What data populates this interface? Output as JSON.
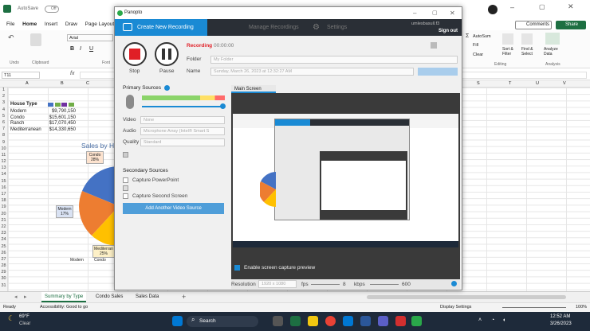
{
  "excel": {
    "autosave": "AutoSave",
    "autosave_state": "Off",
    "menu": [
      "File",
      "Home",
      "Insert",
      "Draw",
      "Page Layout"
    ],
    "comments": "Comments",
    "share": "Share",
    "font": "Arial",
    "clipboard": "Clipboard",
    "font_group": "Font",
    "undo": "Undo",
    "cell_ref": "T11",
    "fx": "fx",
    "editing": "Editing",
    "analysis": "Analysis",
    "autosum": "AutoSum",
    "fill": "Fill",
    "clear": "Clear",
    "sort": "Sort & Filter",
    "find": "Find & Select",
    "analyze": "Analyze Data",
    "columns": [
      "A",
      "B",
      "C",
      "S",
      "T",
      "U",
      "V"
    ],
    "rows": [
      "1",
      "2",
      "3",
      "4",
      "5",
      "6",
      "7",
      "8",
      "9",
      "10",
      "11",
      "12",
      "13",
      "14",
      "15",
      "16",
      "17",
      "18",
      "19",
      "20",
      "21",
      "22",
      "23",
      "24",
      "25",
      "26",
      "27",
      "28",
      "29",
      "30",
      "31"
    ],
    "table": {
      "header": "House Type",
      "rows": [
        {
          "type": "Modern",
          "value": "$9,790,150"
        },
        {
          "type": "Condo",
          "value": "$15,601,150"
        },
        {
          "type": "Ranch",
          "value": "$17,070,450"
        },
        {
          "type": "Mediterranean",
          "value": "$14,330,650"
        }
      ]
    },
    "chart_title": "Sales by H",
    "chart_labels": [
      "Condo 28%",
      "Modern 17%",
      "Mediterran 25%"
    ],
    "legend": [
      "Modern",
      "Condo"
    ],
    "sheets": [
      "Summary by Type",
      "Condo Sales",
      "Sales Data"
    ],
    "status_ready": "Ready",
    "accessibility": "Accessibility: Good to go",
    "display_settings": "Display Settings",
    "zoom": "100%"
  },
  "taskbar": {
    "weather_temp": "69°F",
    "weather_desc": "Clear",
    "search": "Search",
    "time": "12:52 AM",
    "date": "3/26/2023"
  },
  "panopto": {
    "app_name": "Panopto",
    "tabs": [
      "Create New Recording",
      "Manage Recordings",
      "Settings"
    ],
    "user": "umlesbasull.f3",
    "signout": "Sign out",
    "stop": "Stop",
    "pause": "Pause",
    "recording_label": "Recording",
    "recording_time": "00:00:00",
    "folder_label": "Folder",
    "folder_value": "My Folder",
    "name_label": "Name",
    "name_value": "Sunday, March 26, 2023 at 12:32:27 AM",
    "primary_sources": "Primary Sources",
    "video_label": "Video",
    "video_value": "None",
    "audio_label": "Audio",
    "audio_value": "Microphone Array (Intel® Smart S",
    "quality_label": "Quality",
    "quality_value": "Standard",
    "secondary_sources": "Secondary Sources",
    "capture_ppt": "Capture PowerPoint",
    "capture_second": "Capture Second Screen",
    "add_video_source": "Add Another Video Source",
    "main_screen": "Main Screen",
    "enable_capture": "Enable screen capture preview",
    "resolution_label": "Resolution",
    "resolution_value": "1920 x 1080",
    "fps_label": "fps",
    "fps_value": "8",
    "kbps_label": "kbps",
    "kbps_value": "600",
    "accent": "#1a8ad4",
    "record_red": "#e01f26"
  }
}
